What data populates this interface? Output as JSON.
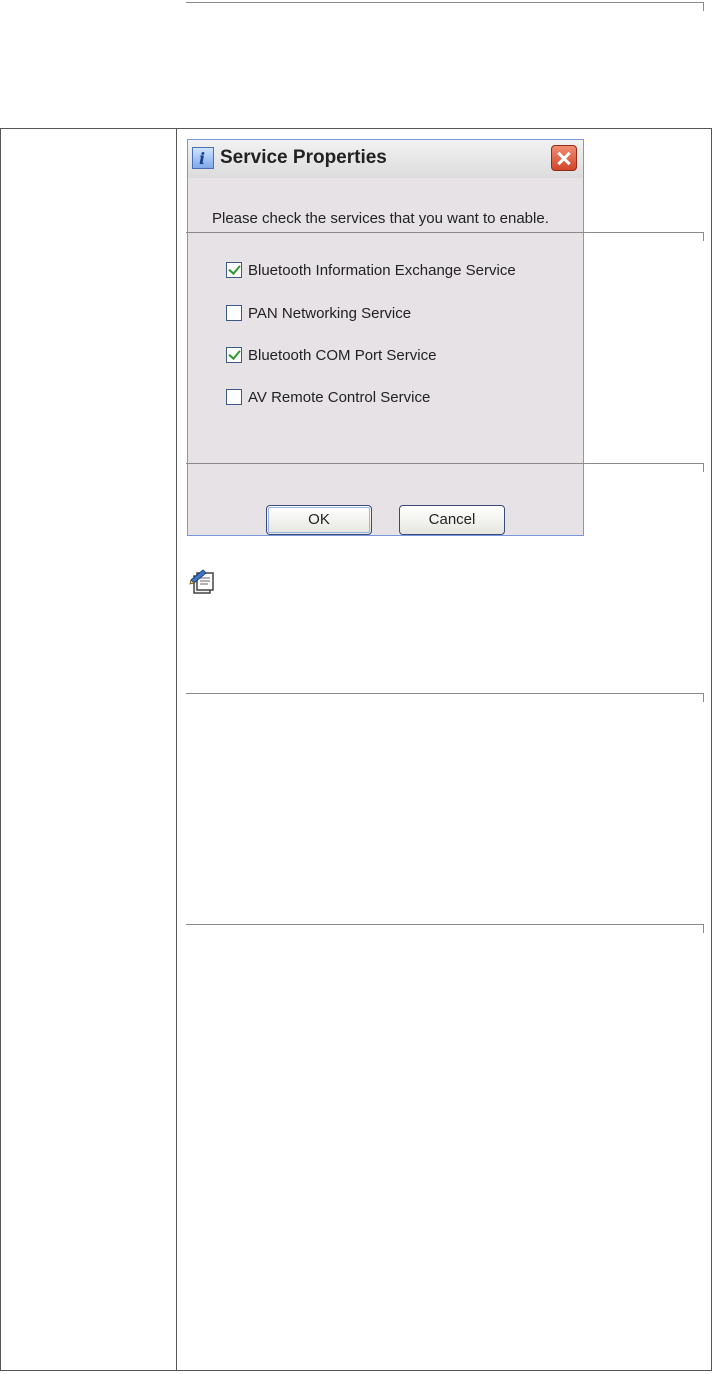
{
  "dialog": {
    "title": "Service Properties",
    "instruction": "Please check the services that you want to enable.",
    "services": [
      {
        "label": "Bluetooth Information Exchange Service",
        "checked": true
      },
      {
        "label": "PAN Networking Service",
        "checked": false
      },
      {
        "label": "Bluetooth COM Port Service",
        "checked": true
      },
      {
        "label": "AV Remote Control Service",
        "checked": false
      }
    ],
    "ok_label": "OK",
    "cancel_label": "Cancel"
  },
  "icons": {
    "title_icon": "info-icon",
    "close_icon": "close-icon",
    "note_icon": "note-icon"
  }
}
